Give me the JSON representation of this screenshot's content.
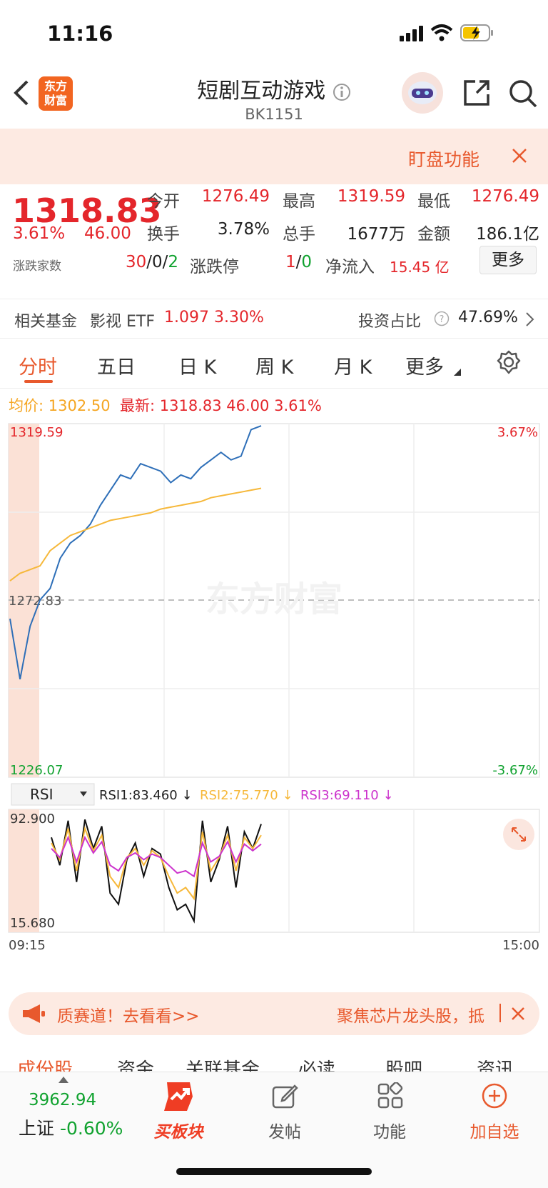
{
  "status": {
    "time": "11:16"
  },
  "header": {
    "title": "短剧互动游戏",
    "code": "BK1151",
    "logo_text_1": "东方",
    "logo_text_2": "财富"
  },
  "banner": {
    "text": "盯盘功能"
  },
  "quote": {
    "price": "1318.83",
    "change_pct": "3.61%",
    "change": "46.00",
    "open_label": "今开",
    "open": "1276.49",
    "high_label": "最高",
    "high": "1319.59",
    "low_label": "最低",
    "low": "1276.49",
    "turnover_label": "换手",
    "turnover": "3.78%",
    "volume_label": "总手",
    "volume": "1677万",
    "amount_label": "金额",
    "amount": "186.1亿",
    "breadth_label": "涨跌家数",
    "breadth_up": "30",
    "breadth_flat": "0",
    "breadth_down": "2",
    "limit_label": "涨跌停",
    "limit_up": "1",
    "limit_down": "0",
    "inflow_label": "净流入",
    "inflow": "15.45 亿",
    "more_button": "更多"
  },
  "fund": {
    "label": "相关基金",
    "name": "影视 ETF",
    "price": "1.097",
    "pct": "3.30%",
    "ratio_label": "投资占比",
    "ratio": "47.69%"
  },
  "tabs": [
    "分时",
    "五日",
    "日 K",
    "周 K",
    "月 K",
    "更多"
  ],
  "legend": {
    "avg_label": "均价:",
    "avg": "1302.50",
    "latest_label": "最新:",
    "latest": "1318.83",
    "latest_change": "46.00",
    "latest_pct": "3.61%"
  },
  "chart": {
    "top_price": "1319.59",
    "mid_price": "1272.83",
    "bottom_price": "1226.07",
    "top_pct": "3.67%",
    "bottom_pct": "-3.67%",
    "watermark": "东方财富",
    "start_time": "09:15",
    "end_time": "15:00",
    "colors": {
      "price": "#2e6fb8",
      "avg": "#f6b83a",
      "rsi1": "#111111",
      "rsi2": "#f6b83a",
      "rsi3": "#cc33cc"
    }
  },
  "rsi": {
    "selector": "RSI",
    "rsi1": "RSI1:83.460 ↓",
    "rsi2": "RSI2:75.770 ↓",
    "rsi3": "RSI3:69.110 ↓",
    "top": "92.900",
    "bottom": "15.680"
  },
  "chart_data": {
    "type": "line",
    "xlabel": "",
    "ylabel": "",
    "x_range": [
      "09:15",
      "15:00"
    ],
    "ylim": [
      1226.07,
      1319.59
    ],
    "reference": 1272.83,
    "series": [
      {
        "values": [
          1268,
          1252,
          1266,
          1273,
          1276,
          1284,
          1288,
          1290,
          1293,
          1298,
          1302,
          1306,
          1305,
          1309,
          1308,
          1307,
          1304,
          1306,
          1305,
          1308,
          1310,
          1312,
          1310,
          1311,
          1318,
          1319
        ]
      },
      {
        "values": [
          1278,
          1280,
          1281,
          1282,
          1286,
          1288,
          1290,
          1291,
          1292,
          1293,
          1294,
          1294.5,
          1295,
          1295.5,
          1296,
          1297,
          1297.5,
          1298,
          1298.5,
          1299,
          1300,
          1300.5,
          1301,
          1301.5,
          1302,
          1302.5
        ]
      }
    ]
  },
  "notice": {
    "text_left": "质赛道！去看看>>",
    "text_right": "聚焦芯片龙头股，抵"
  },
  "subtabs": [
    "成份股",
    "资金",
    "关联基金",
    "必读",
    "股吧",
    "资讯"
  ],
  "bottom": {
    "index_value": "3962.94",
    "index_label": "上证",
    "index_pct": "-0.60%",
    "nav": [
      "买板块",
      "发帖",
      "功能",
      "加自选"
    ]
  }
}
